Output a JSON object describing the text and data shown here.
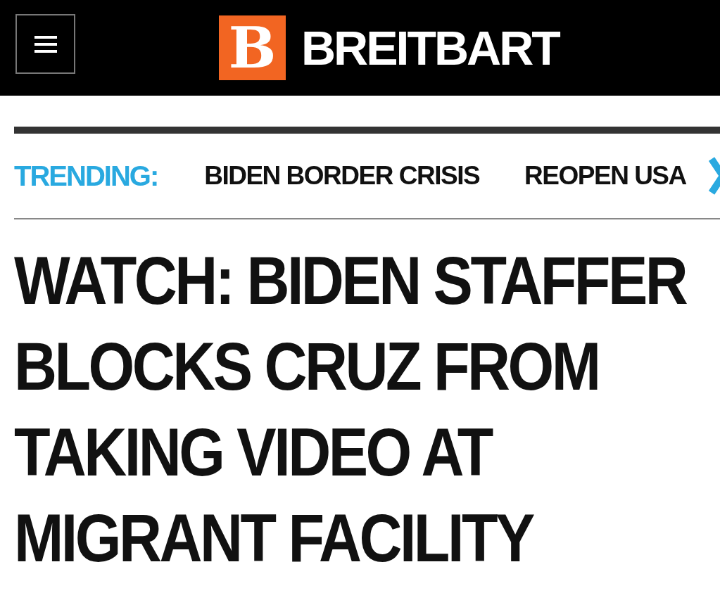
{
  "header": {
    "logo_mark": "B",
    "site_name": "BREITBART"
  },
  "trending": {
    "label": "TRENDING:",
    "items": [
      "BIDEN BORDER CRISIS",
      "REOPEN USA"
    ]
  },
  "headline": "WATCH: BIDEN STAFFER BLOCKS CRUZ FROM TAKING VIDEO AT MIGRANT FACILITY"
}
